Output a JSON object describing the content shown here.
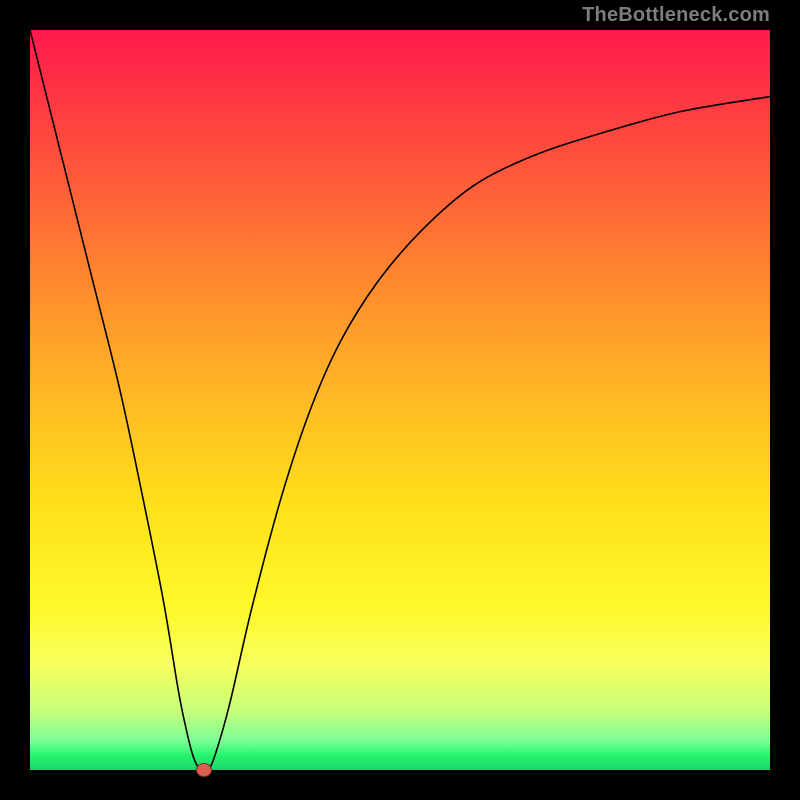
{
  "attribution": "TheBottleneck.com",
  "chart_data": {
    "type": "line",
    "title": "",
    "xlabel": "",
    "ylabel": "",
    "xlim": [
      0,
      100
    ],
    "ylim": [
      0,
      100
    ],
    "series": [
      {
        "name": "bottleneck-curve",
        "x": [
          0,
          4,
          8,
          12,
          15,
          18,
          20,
          21,
          22,
          23,
          24,
          25,
          27,
          30,
          34,
          38,
          42,
          47,
          53,
          60,
          68,
          77,
          88,
          100
        ],
        "values": [
          100,
          84,
          68,
          52,
          38,
          23,
          11,
          6,
          2,
          0,
          0,
          2,
          9,
          22,
          37,
          49,
          58,
          66,
          73,
          79,
          83,
          86,
          89,
          91
        ]
      }
    ],
    "marker": {
      "x": 23.5,
      "y": 0,
      "color": "#d9604f"
    },
    "gradient_stops": [
      {
        "pos": 0,
        "color": "#ff1a4d"
      },
      {
        "pos": 50,
        "color": "#ffe21a"
      },
      {
        "pos": 100,
        "color": "#1bd66a"
      }
    ]
  }
}
